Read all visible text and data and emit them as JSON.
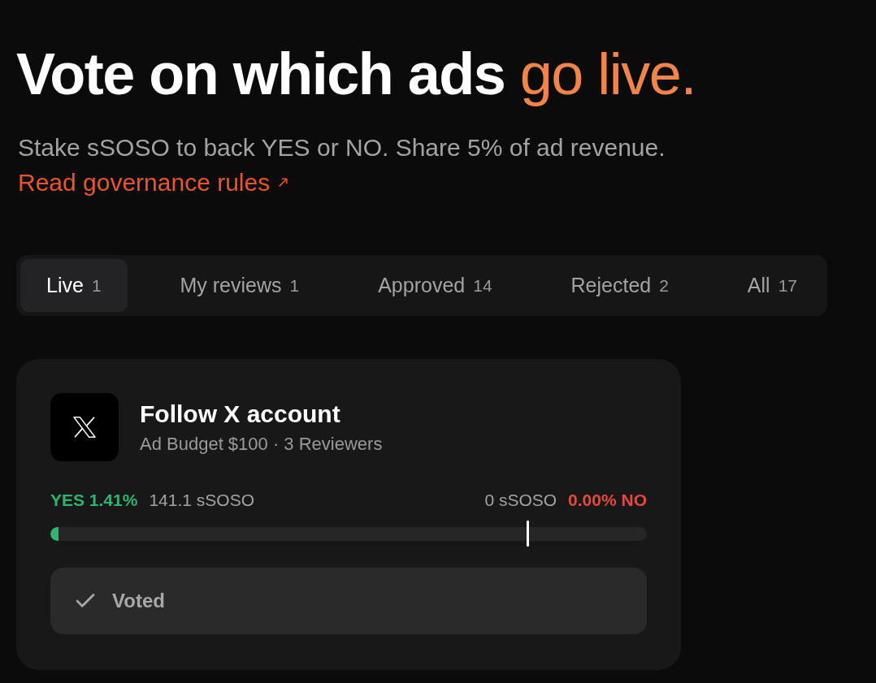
{
  "header": {
    "title": "Vote on which ads",
    "title_accent": "go live.",
    "subtitle": "Stake sSOSO to back YES or NO. Share 5% of ad revenue.",
    "link": "Read governance rules"
  },
  "tabs": [
    {
      "label": "Live",
      "count": "1",
      "selected": true
    },
    {
      "label": "My reviews",
      "count": "1",
      "selected": false
    },
    {
      "label": "Approved",
      "count": "14",
      "selected": false
    },
    {
      "label": "Rejected",
      "count": "2",
      "selected": false
    },
    {
      "label": "All",
      "count": "17",
      "selected": false
    }
  ],
  "ads": [
    {
      "title": "Follow X account",
      "meta": "Ad Budget $100 · 3 Reviewers",
      "yes_label": "YES 1.41%",
      "yes_amount": "141.1 sSOSO",
      "no_amount": "0 sSOSO",
      "no_label": "0.00% NO",
      "yes_bar": {
        "level": 0.0141
      },
      "threshold": {
        "level": 0.8
      },
      "status": {
        "label": "Voted",
        "voted": true
      }
    }
  ]
}
